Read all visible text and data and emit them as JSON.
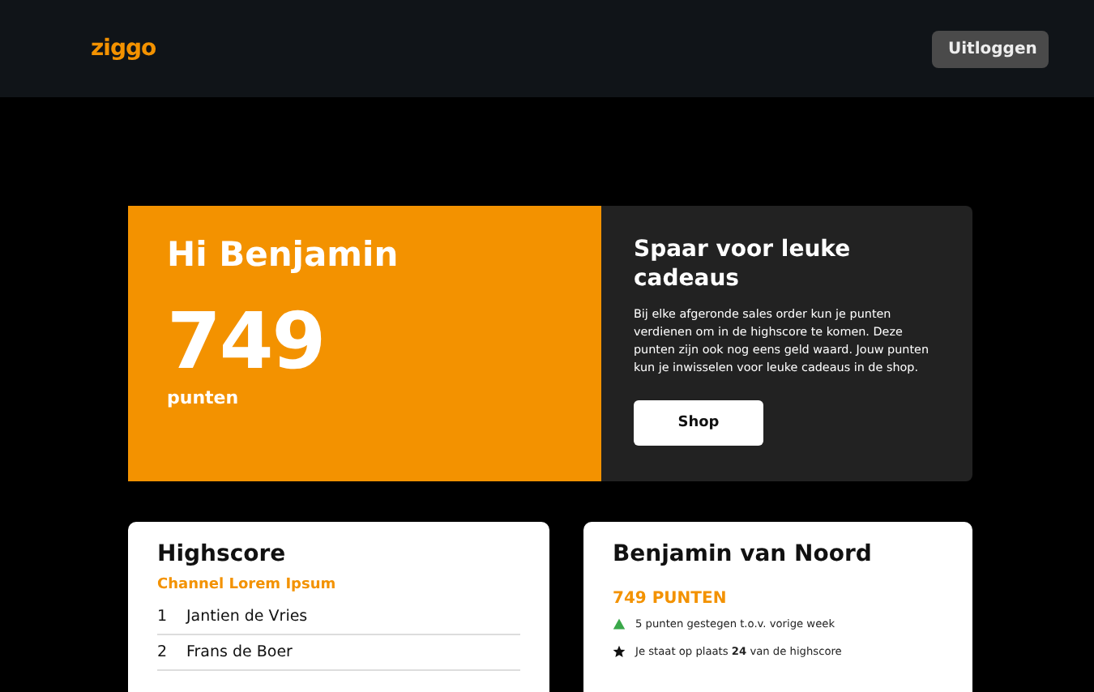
{
  "header": {
    "logo": "ziggo",
    "logout_button": "Uitloggen"
  },
  "hero": {
    "greeting": "Hi Benjamin",
    "points": "749",
    "points_label": "punten",
    "info_title": "Spaar voor leuke cadeaus",
    "info_text": "Bij elke afgeronde sales order kun je punten verdienen om in de highscore te komen. Deze punten zijn ook nog eens geld waard. Jouw punten kun je inwisselen voor leuke cadeaus in de shop.",
    "shop_button": "Shop"
  },
  "highscore": {
    "title": "Highscore",
    "subtitle": "Channel Lorem Ipsum",
    "rows": [
      {
        "rank": "1",
        "name": "Jantien de Vries"
      },
      {
        "rank": "2",
        "name": "Frans de Boer"
      }
    ]
  },
  "profile": {
    "name": "Benjamin van Noord",
    "points": "749 PUNTEN",
    "stats": [
      {
        "kind": "up",
        "text": "5 punten gestegen t.o.v. vorige week"
      },
      {
        "kind": "star",
        "text": "Je staat op plaats **24** van de highscore"
      }
    ]
  }
}
